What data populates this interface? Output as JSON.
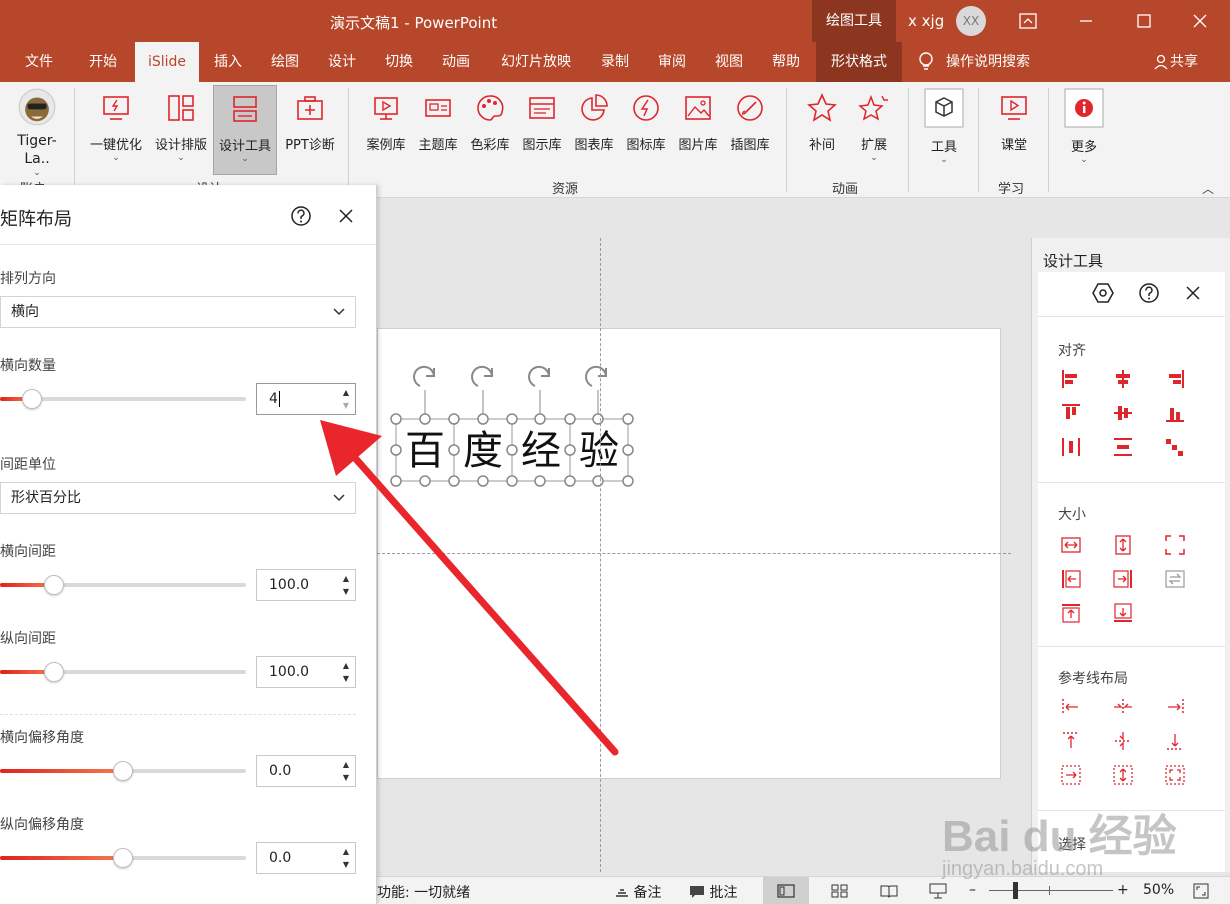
{
  "window": {
    "title": "演示文稿1  -  PowerPoint",
    "context_label": "绘图工具",
    "user": "x xjg",
    "avatar_initials": "XX"
  },
  "tabs": [
    "文件",
    "开始",
    "iSlide",
    "插入",
    "绘图",
    "设计",
    "切换",
    "动画",
    "幻灯片放映",
    "录制",
    "审阅",
    "视图",
    "帮助",
    "形状格式"
  ],
  "active_tab": "iSlide",
  "tell_me": "操作说明搜索",
  "share": "共享",
  "ribbon": {
    "account": {
      "name": "Tiger-La..",
      "group": "账户"
    },
    "design_buttons": [
      "一键优化",
      "设计排版",
      "设计工具",
      "PPT诊断"
    ],
    "design_group": "设计",
    "resource_buttons": [
      "案例库",
      "主题库",
      "色彩库",
      "图示库",
      "图表库",
      "图标库",
      "图片库",
      "插图库"
    ],
    "resource_group": "资源",
    "anim_buttons": [
      "补间",
      "扩展"
    ],
    "anim_group": "动画",
    "tools_button": "工具",
    "learn_button": "课堂",
    "learn_group": "学习",
    "more_button": "更多"
  },
  "matrix_panel": {
    "title": "矩阵布局",
    "direction_label": "排列方向",
    "direction_value": "横向",
    "h_count_label": "横向数量",
    "h_count_value": "4",
    "h_count_level": 0.13,
    "spacing_unit_label": "间距单位",
    "spacing_unit_value": "形状百分比",
    "h_spacing_label": "横向间距",
    "h_spacing_value": "100.0",
    "h_spacing_level": 0.22,
    "v_spacing_label": "纵向间距",
    "v_spacing_value": "100.0",
    "v_spacing_level": 0.22,
    "h_offset_label": "横向偏移角度",
    "h_offset_value": "0.0",
    "h_offset_level": 0.5,
    "v_offset_label": "纵向偏移角度",
    "v_offset_value": "0.0",
    "v_offset_level": 0.5
  },
  "slide": {
    "chars": [
      "百",
      "度",
      "经",
      "验"
    ]
  },
  "design_tools_panel": {
    "title": "设计工具",
    "align_section": "对齐",
    "size_section": "大小",
    "guide_section": "参考线布局",
    "select_section": "选择"
  },
  "status": {
    "text": "功能: 一切就绪",
    "notes": "备注",
    "comments": "批注",
    "zoom": "50%"
  },
  "watermark": {
    "brand": "Bai du 经验",
    "url": "jingyan.baidu.com"
  },
  "colors": {
    "accent": "#b7472a",
    "icon_red": "#e0262d",
    "arrow": "#e8262c"
  }
}
